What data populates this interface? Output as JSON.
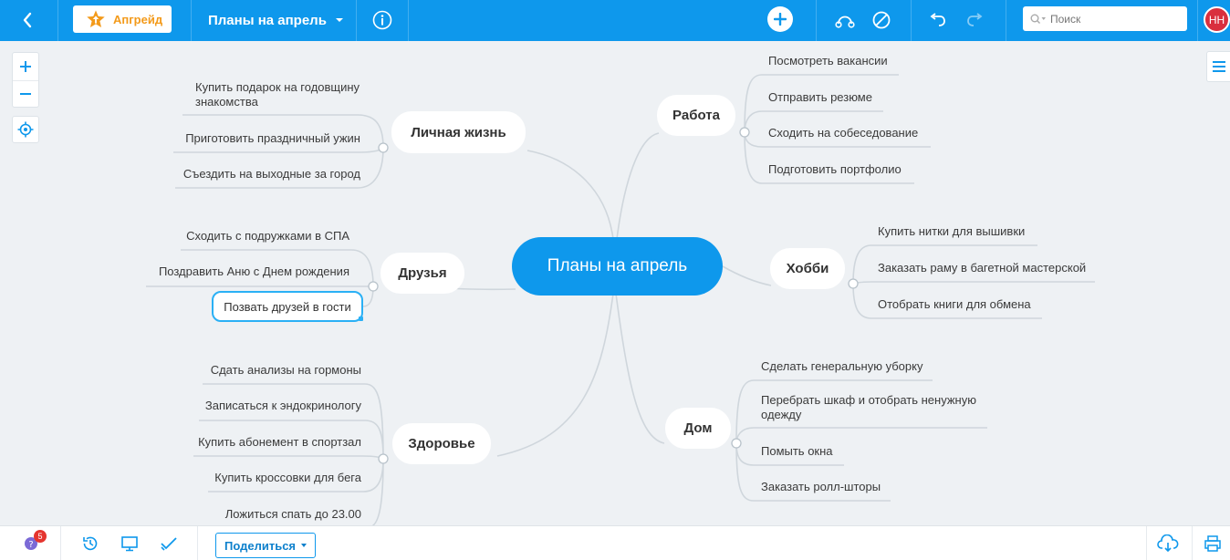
{
  "toolbar": {
    "upgrade_label": "Апгрейд",
    "map_title": "Планы на апрель",
    "search_placeholder": "Поиск",
    "avatar_initials": "НН"
  },
  "map": {
    "central": "Планы на апрель",
    "branches": [
      {
        "title": "Личная жизнь",
        "items": [
          "Купить подарок на годовщину знакомства",
          "Приготовить праздничный ужин",
          "Съездить на выходные за город"
        ]
      },
      {
        "title": "Друзья",
        "items": [
          "Сходить с подружками в СПА",
          "Поздравить Аню с Днем рождения",
          "Позвать друзей в гости"
        ]
      },
      {
        "title": "Здоровье",
        "items": [
          "Сдать анализы на гормоны",
          "Записаться к эндокринологу",
          "Купить абонемент в спортзал",
          "Купить кроссовки для бега",
          "Ложиться спать до 23.00"
        ]
      },
      {
        "title": "Работа",
        "items": [
          "Посмотреть вакансии",
          "Отправить резюме",
          "Сходить на собеседование",
          "Подготовить портфолио"
        ]
      },
      {
        "title": "Хобби",
        "items": [
          "Купить нитки для вышивки",
          "Заказать раму в багетной мастерской",
          "Отобрать книги для обмена"
        ]
      },
      {
        "title": "Дом",
        "items": [
          "Сделать генеральную уборку",
          "Перебрать шкаф и отобрать ненужную одежду",
          "Помыть окна",
          "Заказать ролл-шторы"
        ]
      }
    ]
  },
  "bottombar": {
    "notifications_count": "5",
    "share_label": "Поделиться"
  },
  "colors": {
    "accent": "#0e98ec",
    "connector": "#cfd6dc",
    "selection": "#2ab0f5",
    "upgrade": "#f39a1a",
    "avatar": "#d92f3e"
  }
}
